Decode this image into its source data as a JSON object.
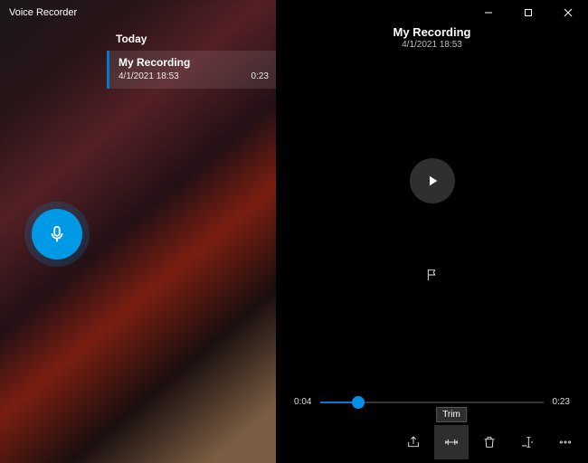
{
  "app_title": "Voice Recorder",
  "sidebar": {
    "section": "Today",
    "items": [
      {
        "name": "My Recording",
        "date": "4/1/2021 18:53",
        "duration": "0:23"
      }
    ]
  },
  "detail": {
    "title": "My Recording",
    "subtitle": "4/1/2021 18:53",
    "current_time": "0:04",
    "total_time": "0:23",
    "progress_pct": 17
  },
  "buttons": {
    "share": "Share",
    "trim": "Trim",
    "delete": "Delete",
    "rename": "Rename",
    "more": "More"
  },
  "tooltip_visible": "Trim",
  "colors": {
    "accent": "#0091ea",
    "record": "#0099e6"
  }
}
